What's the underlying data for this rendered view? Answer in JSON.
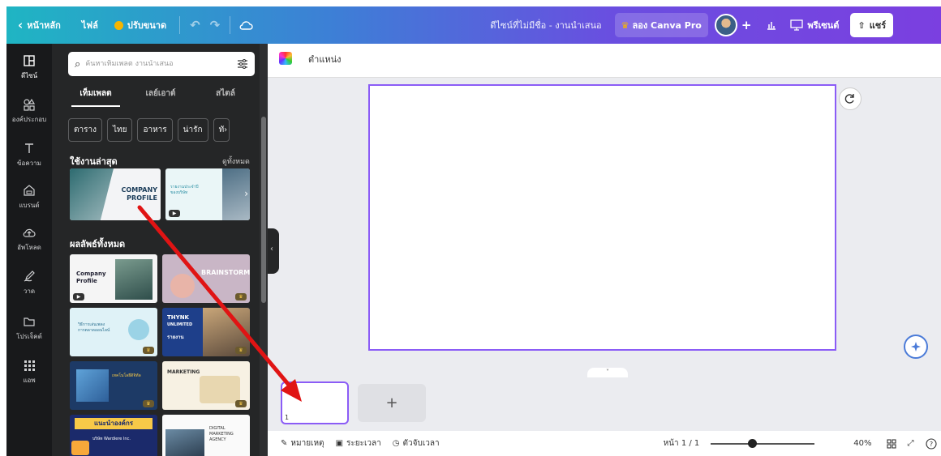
{
  "topbar": {
    "home": "หน้าหลัก",
    "file": "ไฟล์",
    "resize": "ปรับขนาด",
    "doc_title": "ดีไซน์ที่ไม่มีชื่อ - งานนำเสนอ",
    "try_pro": "ลอง Canva Pro",
    "present": "พรีเซนต์",
    "share": "แชร์"
  },
  "rail": {
    "items": [
      "ดีไซน์",
      "องค์ประกอบ",
      "ข้อความ",
      "แบรนด์",
      "อัพโหลด",
      "วาด",
      "โปรเจ็คต์",
      "แอพ"
    ]
  },
  "panel": {
    "search_placeholder": "ค้นหาเท็มเพลต งานนำเสนอ",
    "tabs": [
      "เท็มเพลต",
      "เลย์เอาต์",
      "สไตล์"
    ],
    "chips": [
      "ตาราง",
      "ไทย",
      "อาหาร",
      "น่ารัก",
      "ทั"
    ],
    "recent_title": "ใช้งานล่าสุด",
    "see_all": "ดูทั้งหมด",
    "all_results_title": "ผลลัพธ์ทั้งหมด",
    "templates": {
      "company_profile_a": [
        "COMPANY",
        "PROFILE"
      ],
      "annual_report": [
        "รายงานประจำปี",
        "ของบริษัท"
      ],
      "company_profile_b": [
        "Company",
        "Profile"
      ],
      "brainstorm": "BRAINSTORM",
      "online_marketing": [
        "วิธีการเล่นเพลง",
        "การตลาดออนไลน์"
      ],
      "thynk": [
        "THYNK",
        "UNLIMITED",
        "รายงาน"
      ],
      "tech_lesson": "เทคโนโลยีดิจิทัล",
      "marketing": "MARKETING",
      "company_intro": [
        "แนะนำองค์กร",
        "บริษัท Wardiere Inc."
      ],
      "digital_agency": [
        "DIGITAL",
        "MARKETING",
        "AGENCY"
      ]
    }
  },
  "editor": {
    "toolbar_position": "ตำแหน่ง",
    "page_number_label": "1",
    "add_page": "+",
    "chevron": "˅"
  },
  "footer": {
    "notes": "หมายเหตุ",
    "duration": "ระยะเวลา",
    "timer": "ตัวจับเวลา",
    "page_count": "หน้า 1 / 1",
    "zoom": "40%",
    "zoom_fraction": 0.4
  },
  "colors": {
    "accent": "#8b5cf6",
    "arrow": "#e01414",
    "panel": "#252627",
    "rail": "#18191b"
  }
}
